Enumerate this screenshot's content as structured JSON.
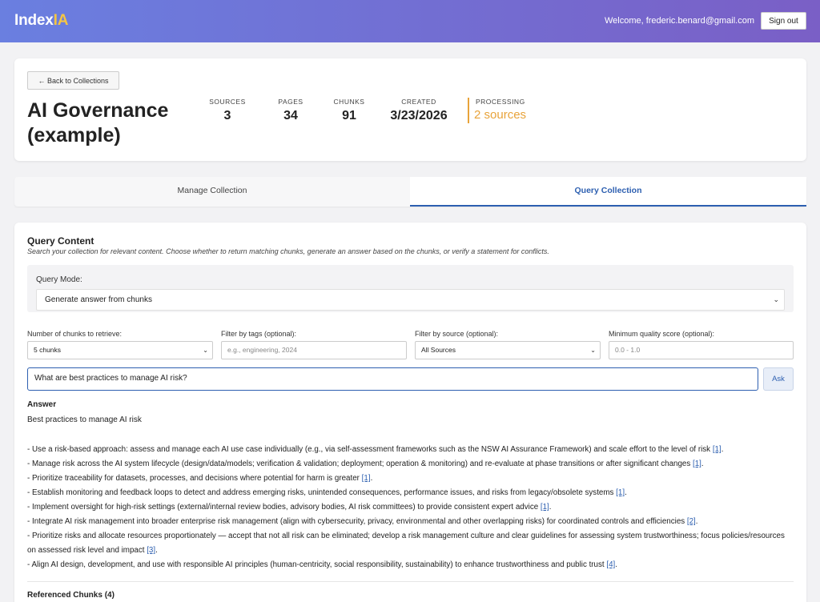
{
  "app": {
    "logo_main": "Index",
    "logo_accent": "IA",
    "welcome": "Welcome, frederic.benard@gmail.com",
    "sign_out": "Sign out"
  },
  "header": {
    "back": "← Back to Collections",
    "title": "AI Governance (example)",
    "stats": [
      {
        "label": "SOURCES",
        "value": "3"
      },
      {
        "label": "PAGES",
        "value": "34"
      },
      {
        "label": "CHUNKS",
        "value": "91"
      },
      {
        "label": "CREATED",
        "value": "3/23/2026"
      },
      {
        "label": "PROCESSING",
        "value": "2 sources"
      }
    ]
  },
  "tabs": {
    "manage": "Manage Collection",
    "query": "Query Collection"
  },
  "query": {
    "title": "Query Content",
    "description": "Search your collection for relevant content. Choose whether to return matching chunks, generate an answer based on the chunks, or verify a statement for conflicts.",
    "mode_label": "Query Mode:",
    "mode_value": "Generate answer from chunks",
    "filters": {
      "chunks_label": "Number of chunks to retrieve:",
      "chunks_value": "5 chunks",
      "tags_label": "Filter by tags (optional):",
      "tags_placeholder": "e.g., engineering, 2024",
      "source_label": "Filter by source (optional):",
      "source_value": "All Sources",
      "quality_label": "Minimum quality score (optional):",
      "quality_placeholder": "0.0 - 1.0"
    },
    "input_value": "What are best practices to manage AI risk?",
    "ask": "Ask"
  },
  "answer": {
    "title": "Answer",
    "heading": "Best practices to manage AI risk",
    "items": [
      {
        "text": "- Use a risk-based approach: assess and manage each AI use case individually (e.g., via self-assessment frameworks such as the NSW AI Assurance Framework) and scale effort to the level of risk ",
        "cite": "[1]",
        "end": "."
      },
      {
        "text": "- Manage risk across the AI system lifecycle (design/data/models; verification & validation; deployment; operation & monitoring) and re-evaluate at phase transitions or after significant changes ",
        "cite": "[1]",
        "end": "."
      },
      {
        "text": "- Prioritize traceability for datasets, processes, and decisions where potential for harm is greater ",
        "cite": "[1]",
        "end": "."
      },
      {
        "text": "- Establish monitoring and feedback loops to detect and address emerging risks, unintended consequences, performance issues, and risks from legacy/obsolete systems ",
        "cite": "[1]",
        "end": "."
      },
      {
        "text": "- Implement oversight for high-risk settings (external/internal review bodies, advisory bodies, AI risk committees) to provide consistent expert advice ",
        "cite": "[1]",
        "end": "."
      },
      {
        "text": "- Integrate AI risk management into broader enterprise risk management (align with cybersecurity, privacy, environmental and other overlapping risks) for coordinated controls and efficiencies ",
        "cite": "[2]",
        "end": "."
      },
      {
        "text": "- Prioritize risks and allocate resources proportionately — accept that not all risk can be eliminated; develop a risk management culture and clear guidelines for assessing system trustworthiness; focus policies/resources on assessed risk level and impact ",
        "cite": "[3]",
        "end": "."
      },
      {
        "text": "- Align AI design, development, and use with responsible AI principles (human-centricity, social responsibility, sustainability) to enhance trustworthiness and public trust ",
        "cite": "[4]",
        "end": "."
      }
    ]
  },
  "referenced": {
    "title": "Referenced Chunks (4)"
  }
}
